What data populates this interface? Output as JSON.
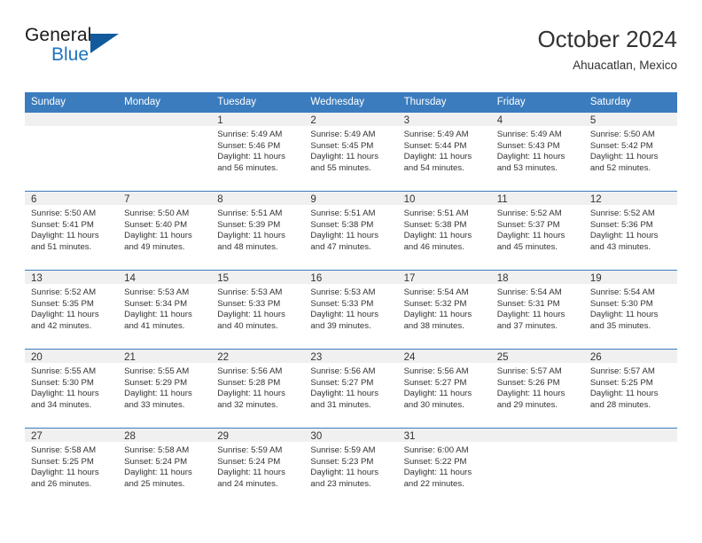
{
  "brand": {
    "word1": "General",
    "word2": "Blue",
    "logo_icon": "triangle-logo-icon",
    "accent_color": "#1e73be"
  },
  "header": {
    "title": "October 2024",
    "subtitle": "Ahuacatlan, Mexico"
  },
  "calendar": {
    "header_color": "#3b7cbe",
    "day_band_color": "#f0f0f0",
    "weekday_headers": [
      "Sunday",
      "Monday",
      "Tuesday",
      "Wednesday",
      "Thursday",
      "Friday",
      "Saturday"
    ],
    "weeks": [
      [
        {
          "date": "",
          "empty": true
        },
        {
          "date": "",
          "empty": true
        },
        {
          "date": "1",
          "sunrise": "Sunrise: 5:49 AM",
          "sunset": "Sunset: 5:46 PM",
          "daylight": "Daylight: 11 hours and 56 minutes."
        },
        {
          "date": "2",
          "sunrise": "Sunrise: 5:49 AM",
          "sunset": "Sunset: 5:45 PM",
          "daylight": "Daylight: 11 hours and 55 minutes."
        },
        {
          "date": "3",
          "sunrise": "Sunrise: 5:49 AM",
          "sunset": "Sunset: 5:44 PM",
          "daylight": "Daylight: 11 hours and 54 minutes."
        },
        {
          "date": "4",
          "sunrise": "Sunrise: 5:49 AM",
          "sunset": "Sunset: 5:43 PM",
          "daylight": "Daylight: 11 hours and 53 minutes."
        },
        {
          "date": "5",
          "sunrise": "Sunrise: 5:50 AM",
          "sunset": "Sunset: 5:42 PM",
          "daylight": "Daylight: 11 hours and 52 minutes."
        }
      ],
      [
        {
          "date": "6",
          "sunrise": "Sunrise: 5:50 AM",
          "sunset": "Sunset: 5:41 PM",
          "daylight": "Daylight: 11 hours and 51 minutes."
        },
        {
          "date": "7",
          "sunrise": "Sunrise: 5:50 AM",
          "sunset": "Sunset: 5:40 PM",
          "daylight": "Daylight: 11 hours and 49 minutes."
        },
        {
          "date": "8",
          "sunrise": "Sunrise: 5:51 AM",
          "sunset": "Sunset: 5:39 PM",
          "daylight": "Daylight: 11 hours and 48 minutes."
        },
        {
          "date": "9",
          "sunrise": "Sunrise: 5:51 AM",
          "sunset": "Sunset: 5:38 PM",
          "daylight": "Daylight: 11 hours and 47 minutes."
        },
        {
          "date": "10",
          "sunrise": "Sunrise: 5:51 AM",
          "sunset": "Sunset: 5:38 PM",
          "daylight": "Daylight: 11 hours and 46 minutes."
        },
        {
          "date": "11",
          "sunrise": "Sunrise: 5:52 AM",
          "sunset": "Sunset: 5:37 PM",
          "daylight": "Daylight: 11 hours and 45 minutes."
        },
        {
          "date": "12",
          "sunrise": "Sunrise: 5:52 AM",
          "sunset": "Sunset: 5:36 PM",
          "daylight": "Daylight: 11 hours and 43 minutes."
        }
      ],
      [
        {
          "date": "13",
          "sunrise": "Sunrise: 5:52 AM",
          "sunset": "Sunset: 5:35 PM",
          "daylight": "Daylight: 11 hours and 42 minutes."
        },
        {
          "date": "14",
          "sunrise": "Sunrise: 5:53 AM",
          "sunset": "Sunset: 5:34 PM",
          "daylight": "Daylight: 11 hours and 41 minutes."
        },
        {
          "date": "15",
          "sunrise": "Sunrise: 5:53 AM",
          "sunset": "Sunset: 5:33 PM",
          "daylight": "Daylight: 11 hours and 40 minutes."
        },
        {
          "date": "16",
          "sunrise": "Sunrise: 5:53 AM",
          "sunset": "Sunset: 5:33 PM",
          "daylight": "Daylight: 11 hours and 39 minutes."
        },
        {
          "date": "17",
          "sunrise": "Sunrise: 5:54 AM",
          "sunset": "Sunset: 5:32 PM",
          "daylight": "Daylight: 11 hours and 38 minutes."
        },
        {
          "date": "18",
          "sunrise": "Sunrise: 5:54 AM",
          "sunset": "Sunset: 5:31 PM",
          "daylight": "Daylight: 11 hours and 37 minutes."
        },
        {
          "date": "19",
          "sunrise": "Sunrise: 5:54 AM",
          "sunset": "Sunset: 5:30 PM",
          "daylight": "Daylight: 11 hours and 35 minutes."
        }
      ],
      [
        {
          "date": "20",
          "sunrise": "Sunrise: 5:55 AM",
          "sunset": "Sunset: 5:30 PM",
          "daylight": "Daylight: 11 hours and 34 minutes."
        },
        {
          "date": "21",
          "sunrise": "Sunrise: 5:55 AM",
          "sunset": "Sunset: 5:29 PM",
          "daylight": "Daylight: 11 hours and 33 minutes."
        },
        {
          "date": "22",
          "sunrise": "Sunrise: 5:56 AM",
          "sunset": "Sunset: 5:28 PM",
          "daylight": "Daylight: 11 hours and 32 minutes."
        },
        {
          "date": "23",
          "sunrise": "Sunrise: 5:56 AM",
          "sunset": "Sunset: 5:27 PM",
          "daylight": "Daylight: 11 hours and 31 minutes."
        },
        {
          "date": "24",
          "sunrise": "Sunrise: 5:56 AM",
          "sunset": "Sunset: 5:27 PM",
          "daylight": "Daylight: 11 hours and 30 minutes."
        },
        {
          "date": "25",
          "sunrise": "Sunrise: 5:57 AM",
          "sunset": "Sunset: 5:26 PM",
          "daylight": "Daylight: 11 hours and 29 minutes."
        },
        {
          "date": "26",
          "sunrise": "Sunrise: 5:57 AM",
          "sunset": "Sunset: 5:25 PM",
          "daylight": "Daylight: 11 hours and 28 minutes."
        }
      ],
      [
        {
          "date": "27",
          "sunrise": "Sunrise: 5:58 AM",
          "sunset": "Sunset: 5:25 PM",
          "daylight": "Daylight: 11 hours and 26 minutes."
        },
        {
          "date": "28",
          "sunrise": "Sunrise: 5:58 AM",
          "sunset": "Sunset: 5:24 PM",
          "daylight": "Daylight: 11 hours and 25 minutes."
        },
        {
          "date": "29",
          "sunrise": "Sunrise: 5:59 AM",
          "sunset": "Sunset: 5:24 PM",
          "daylight": "Daylight: 11 hours and 24 minutes."
        },
        {
          "date": "30",
          "sunrise": "Sunrise: 5:59 AM",
          "sunset": "Sunset: 5:23 PM",
          "daylight": "Daylight: 11 hours and 23 minutes."
        },
        {
          "date": "31",
          "sunrise": "Sunrise: 6:00 AM",
          "sunset": "Sunset: 5:22 PM",
          "daylight": "Daylight: 11 hours and 22 minutes."
        },
        {
          "date": "",
          "empty": true
        },
        {
          "date": "",
          "empty": true
        }
      ]
    ]
  }
}
